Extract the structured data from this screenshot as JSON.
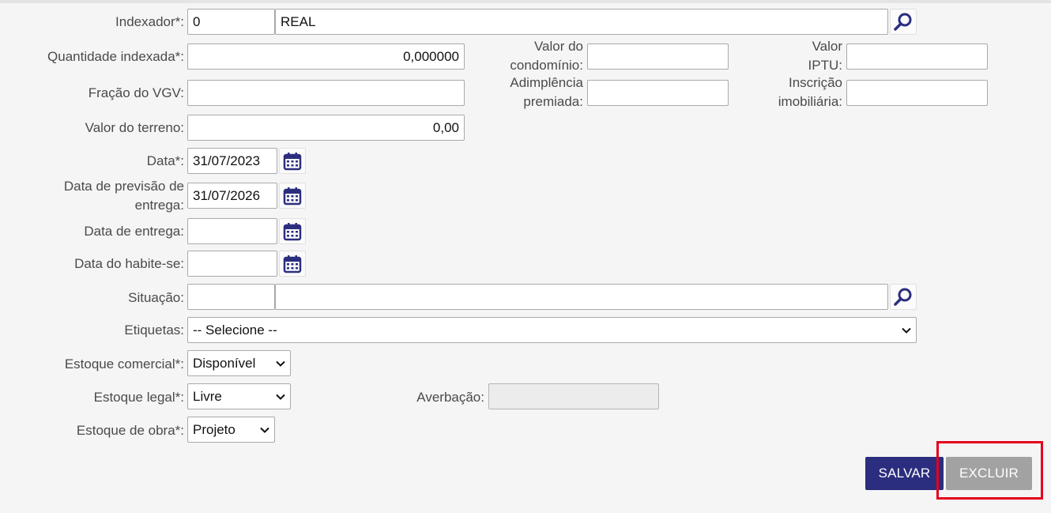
{
  "form": {
    "indexador": {
      "label": "Indexador*:",
      "code": "0",
      "name": "REAL"
    },
    "quantidade_indexada": {
      "label": "Quantidade indexada*:",
      "value": "0,000000"
    },
    "fracao_vgv": {
      "label": "Fração do VGV:",
      "value": ""
    },
    "valor_terreno": {
      "label": "Valor do terreno:",
      "value": "0,00"
    },
    "data": {
      "label": "Data*:",
      "value": "31/07/2023"
    },
    "data_previsao": {
      "label_line1": "Data de previsão de",
      "label_line2": "entrega:",
      "value": "31/07/2026"
    },
    "data_entrega": {
      "label": "Data de entrega:",
      "value": ""
    },
    "data_habite": {
      "label": "Data do habite-se:",
      "value": ""
    },
    "situacao": {
      "label": "Situação:",
      "code": "",
      "name": ""
    },
    "etiquetas": {
      "label": "Etiquetas:",
      "selected": "-- Selecione --"
    },
    "estoque_comercial": {
      "label": "Estoque comercial*:",
      "selected": "Disponível"
    },
    "estoque_legal": {
      "label": "Estoque legal*:",
      "selected": "Livre"
    },
    "estoque_obra": {
      "label": "Estoque de obra*:",
      "selected": "Projeto"
    },
    "valor_condominio": {
      "label_line1": "Valor do",
      "label_line2": "condomínio:",
      "value": ""
    },
    "valor_iptu": {
      "label_line1": "Valor",
      "label_line2": "IPTU:",
      "value": ""
    },
    "adimplencia_premiada": {
      "label_line1": "Adimplência",
      "label_line2": "premiada:",
      "value": ""
    },
    "inscricao_imobiliaria": {
      "label_line1": "Inscrição",
      "label_line2": "imobiliária:",
      "value": ""
    },
    "averbacao": {
      "label": "Averbação:",
      "value": ""
    }
  },
  "actions": {
    "save_label": "SALVAR",
    "delete_label": "EXCLUIR"
  },
  "icons": {
    "search": "magnifier-icon",
    "calendar": "calendar-icon",
    "dropdown": "chevron-down-icon"
  },
  "colors": {
    "primary": "#2b2e7e",
    "disabled_button": "#a2a2a2",
    "highlight": "#e3001b",
    "icon": "#2b2e7e"
  }
}
